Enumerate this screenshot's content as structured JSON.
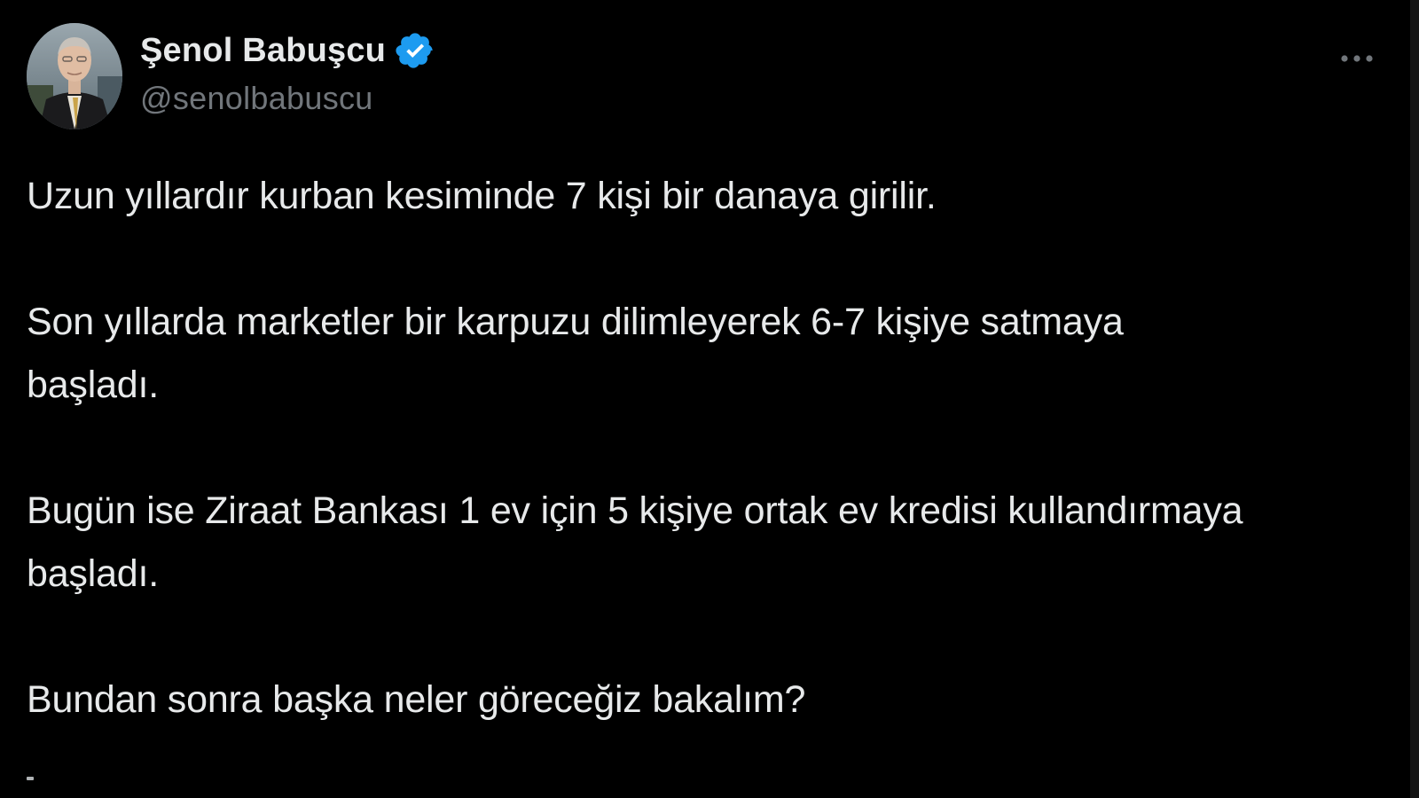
{
  "tweet": {
    "author": {
      "display_name": "Şenol Babuşcu",
      "handle": "@senolbabuscu",
      "verified": true,
      "avatar_icon": "profile-photo",
      "verified_icon": "verified-badge-icon"
    },
    "more_icon": "more-options-icon",
    "paragraphs": [
      "Uzun yıllardır kurban kesiminde 7 kişi bir danaya girilir.",
      "Son yıllarda marketler bir karpuzu dilimleyerek 6-7 kişiye satmaya\nbaşladı.",
      "Bugün ise Ziraat Bankası 1 ev için 5 kişiye ortak ev kredisi kullandırmaya\nbaşladı.",
      "Bundan sonra başka neler göreceğiz bakalım?"
    ]
  },
  "colors": {
    "background": "#000000",
    "text_primary": "#e7e9ea",
    "text_secondary": "#71767b",
    "verified_blue": "#1d9bf0"
  }
}
